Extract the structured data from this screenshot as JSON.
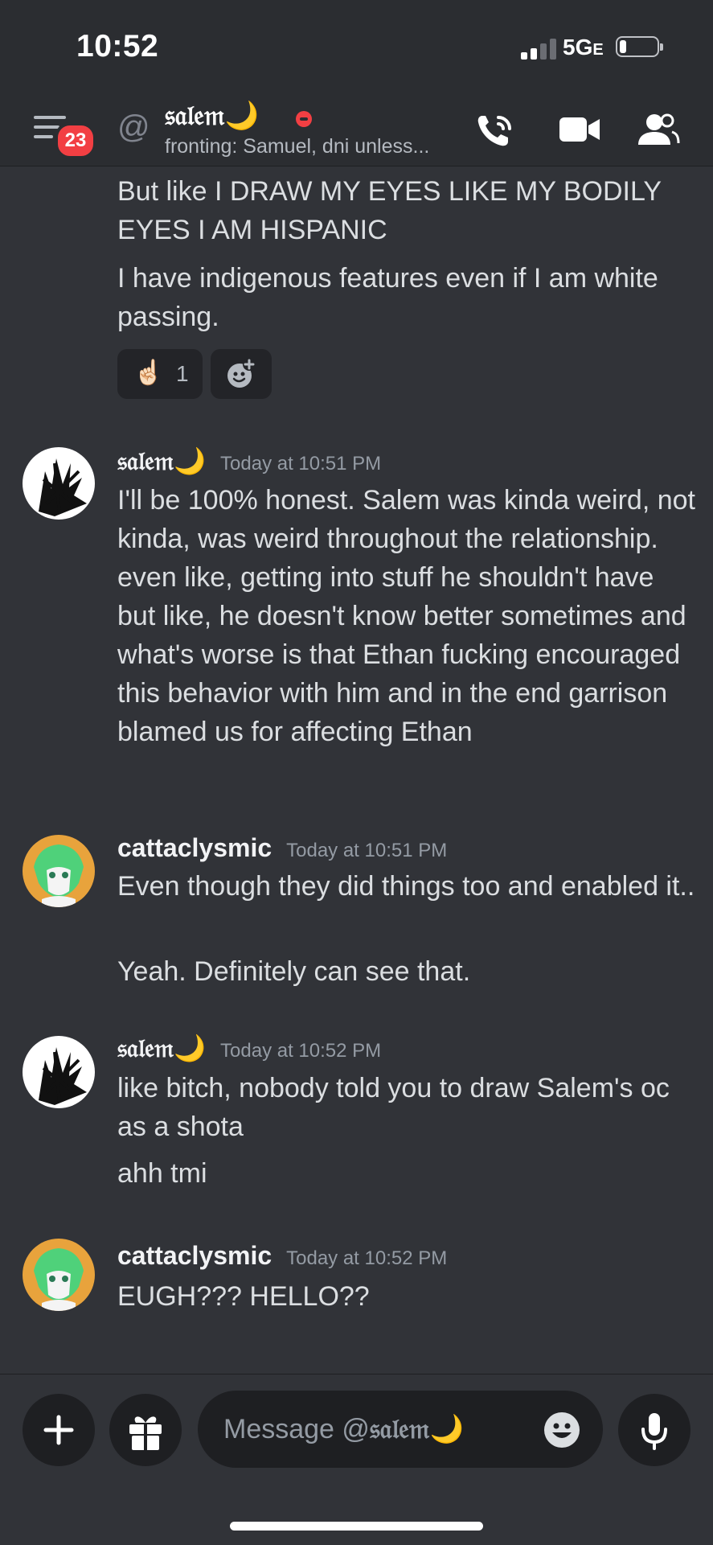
{
  "status_bar": {
    "time": "10:52",
    "network": "5G",
    "network_suffix": "E"
  },
  "header": {
    "unread_badge": "23",
    "at_symbol": "@",
    "dm_name": "𝔰𝔞𝔩𝔢𝔪",
    "dm_emoji": "🌙",
    "status_text": "fronting: Samuel, dni unless..."
  },
  "messages": {
    "cont1": "But like I DRAW MY EYES LIKE MY BODILY EYES I AM HISPANIC",
    "cont2": "I have indigenous features even if I am white passing.",
    "reaction": {
      "emoji": "☝🏻",
      "count": "1"
    },
    "m1": {
      "author": "𝔰𝔞𝔩𝔢𝔪",
      "emoji": "🌙",
      "timestamp": "Today at 10:51 PM",
      "text": "I'll be 100% honest. Salem was kinda weird, not kinda, was weird throughout the relationship. even like, getting into stuff he shouldn't have but like, he doesn't know better sometimes and what's worse is that Ethan fucking encouraged this behavior with him and in the end garrison blamed us for affecting Ethan"
    },
    "m2": {
      "author": "cattaclysmic",
      "timestamp": "Today at 10:51 PM",
      "text1": "Even though they did things too and enabled it..",
      "text2": "Yeah. Definitely can see that."
    },
    "m3": {
      "author": "𝔰𝔞𝔩𝔢𝔪",
      "emoji": "🌙",
      "timestamp": "Today at 10:52 PM",
      "text1": "like bitch, nobody told you to draw Salem's oc as a shota",
      "text2": "ahh tmi"
    },
    "m4": {
      "author": "cattaclysmic",
      "timestamp": "Today at 10:52 PM",
      "text": "EUGH??? HELLO??"
    }
  },
  "composer": {
    "placeholder_prefix": "Message @",
    "placeholder_name": "𝔰𝔞𝔩𝔢𝔪",
    "placeholder_emoji": "🌙"
  },
  "colors": {
    "background": "#313338",
    "header": "#2b2d31",
    "badge": "#f23f43",
    "dnd_status": "#f23f43",
    "input": "#1e1f22",
    "avatar_cattaclysmic": "#e8a33c"
  },
  "icons": [
    "menu-icon",
    "at-icon",
    "dnd-status-icon",
    "phone-call-icon",
    "video-call-icon",
    "members-icon",
    "add-reaction-icon",
    "plus-icon",
    "gift-icon",
    "emoji-icon",
    "microphone-icon"
  ]
}
